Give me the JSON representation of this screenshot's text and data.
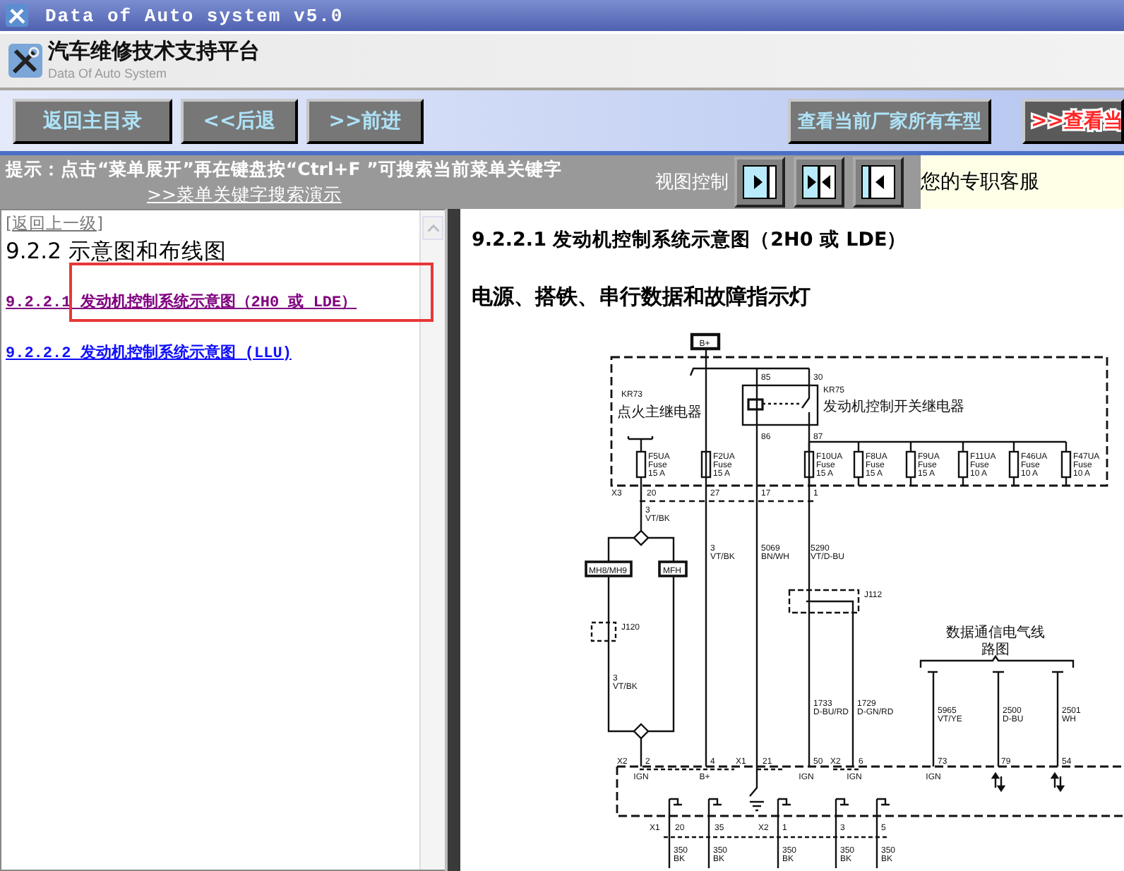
{
  "window": {
    "title": "Data of Auto system v5.0"
  },
  "header": {
    "title": "汽车维修技术支持平台",
    "subtitle": "Data Of Auto System"
  },
  "nav_buttons": [
    "返回主目录",
    "<<后退",
    ">>前进"
  ],
  "right_buttons": [
    {
      "label": "查看当前厂家所有车型",
      "kind": "plain"
    },
    {
      "label": ">>查看当",
      "kind": "highlight"
    }
  ],
  "hint": {
    "text": "提示：点击“菜单展开”再在键盘按“Ctrl+F ”可搜索当前菜单关键字",
    "link": ">>菜单关键字搜索演示"
  },
  "view_control": {
    "label": "视图控制",
    "buttons": [
      {
        "kind": "right"
      },
      {
        "kind": "center"
      },
      {
        "kind": "left"
      }
    ]
  },
  "service": "您的专职客服",
  "sidebar": {
    "back_link": "[返回上一级]",
    "heading": "9.2.2 示意图和布线图",
    "items": [
      {
        "label": "9.2.2.1 发动机控制系统示意图（2H0 或 LDE）",
        "visited": true,
        "highlighted": true
      },
      {
        "label": "9.2.2.2 发动机控制系统示意图 (LLU)",
        "visited": false,
        "highlighted": false
      }
    ]
  },
  "content": {
    "title": "9.2.2.1 发动机控制系统示意图（2H0 或 LDE）",
    "subtitle": "电源、搭铁、串行数据和故障指示灯",
    "diagram": {
      "fuses": [
        {
          "name": "F5UA",
          "type": "Fuse",
          "rating": "15 A"
        },
        {
          "name": "F2UA",
          "type": "Fuse",
          "rating": "15 A"
        },
        {
          "name": "F10UA",
          "type": "Fuse",
          "rating": "15 A"
        },
        {
          "name": "F8UA",
          "type": "Fuse",
          "rating": "15 A"
        },
        {
          "name": "F9UA",
          "type": "Fuse",
          "rating": "15 A"
        },
        {
          "name": "F11UA",
          "type": "Fuse",
          "rating": "10 A"
        },
        {
          "name": "F46UA",
          "type": "Fuse",
          "rating": "10 A"
        },
        {
          "name": "F47UA",
          "type": "Fuse",
          "rating": "10 A"
        }
      ],
      "labels": [
        "B+",
        "85",
        "30",
        "KR75",
        "发动机控制开关继电器",
        "86",
        "87",
        "KR73",
        "点火主继电器",
        "X3",
        "20",
        "27",
        "17",
        "1",
        "3",
        "VT/BK",
        "MH8/MH9",
        "MFH",
        "3",
        "VT/BK",
        "5069",
        "BN/WH",
        "5290",
        "VT/D-BU",
        "J112",
        "J120",
        "数据通信电气线",
        "路图",
        "3",
        "VT/BK",
        "1733",
        "D-BU/RD",
        "1729",
        "D-GN/RD",
        "5965",
        "VT/YE",
        "2500",
        "D-BU",
        "2501",
        "WH",
        "X2",
        "2",
        "4",
        "X1",
        "21",
        "50",
        "X2",
        "6",
        "73",
        "79",
        "54",
        "IGN",
        "B+",
        "IGN",
        "IGN",
        "IGN",
        "X1",
        "20",
        "35",
        "X2",
        "1",
        "3",
        "5",
        "350",
        "BK",
        "350",
        "BK",
        "350",
        "BK",
        "350",
        "BK",
        "350",
        "BK"
      ]
    }
  }
}
